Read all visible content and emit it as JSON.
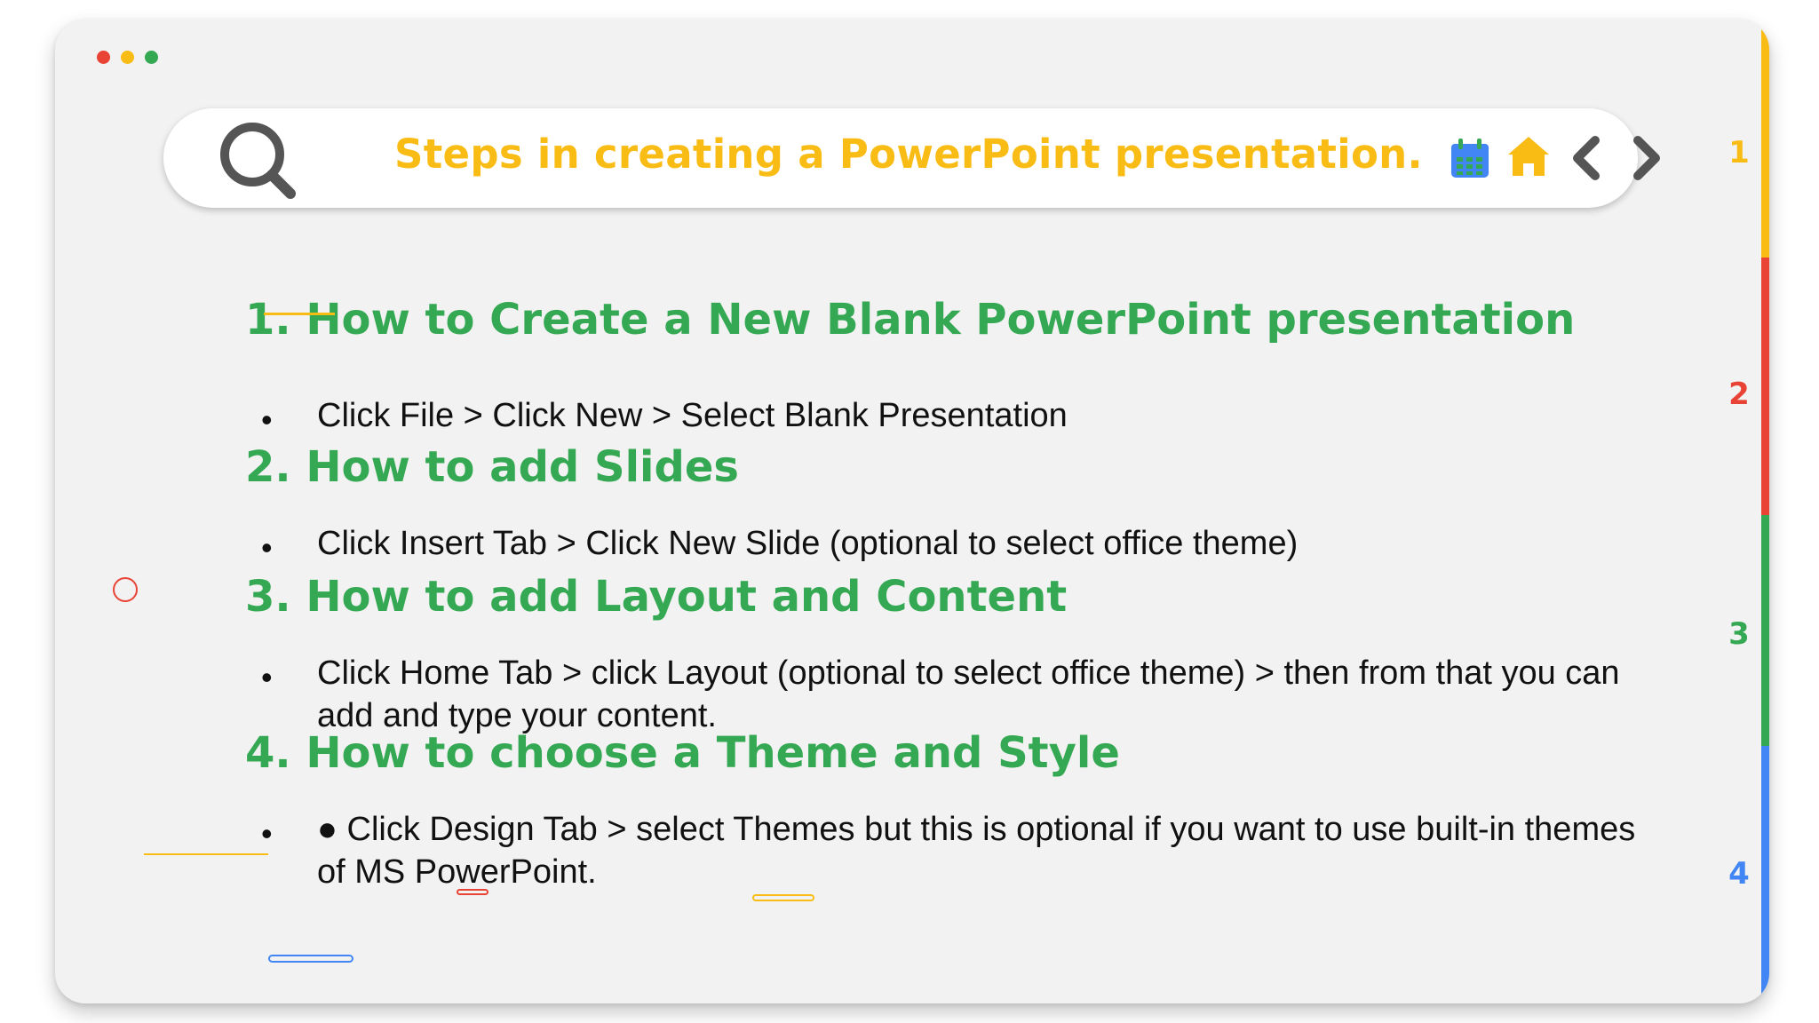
{
  "window": {
    "controls": [
      "close",
      "minimize",
      "maximize"
    ]
  },
  "toolbar": {
    "title": "Steps in creating a PowerPoint presentation.",
    "icons": [
      "search-icon",
      "calendar-icon",
      "home-icon",
      "chevron-left-icon",
      "chevron-right-icon"
    ]
  },
  "tabs": [
    {
      "label": "1",
      "color": "#f9bc15"
    },
    {
      "label": "2",
      "color": "#e94335"
    },
    {
      "label": "3",
      "color": "#34a853"
    },
    {
      "label": "4",
      "color": "#4285f4"
    }
  ],
  "sections": [
    {
      "heading": "1. How to Create a New Blank PowerPoint presentation",
      "bullet": "•",
      "text": "Click File > Click New > Select Blank Presentation"
    },
    {
      "heading": "2. How to add Slides",
      "bullet": "•",
      "text": "Click Insert Tab > Click New Slide (optional to select office theme)"
    },
    {
      "heading": "3. How to add Layout and Content",
      "bullet": "•",
      "text": "Click Home Tab > click Layout (optional to select office theme) > then from that you can add and type your content."
    },
    {
      "heading": "4. How to choose a Theme and Style",
      "bullet": "•",
      "text": "● Click Design Tab > select Themes but this is optional if you want to use built-in themes of MS PowerPoint."
    }
  ],
  "colors": {
    "accent_yellow": "#f9bc15",
    "accent_red": "#e94335",
    "accent_green": "#34a853",
    "accent_blue": "#4285f4",
    "window_bg": "#f2f2f2"
  }
}
